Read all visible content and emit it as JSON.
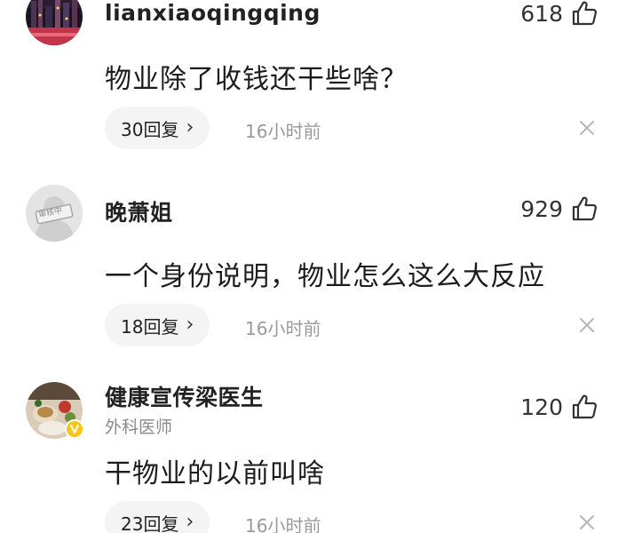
{
  "comments": [
    {
      "username": "lianxiaoqingqing",
      "likes": "618",
      "text": "物业除了收钱还干些啥？",
      "reply_label": "30回复",
      "time": "16小时前"
    },
    {
      "username": "晚萧姐",
      "avatar_stamp": "审核中",
      "likes": "929",
      "text": "一个身份说明，物业怎么这么大反应",
      "reply_label": "18回复",
      "time": "16小时前"
    },
    {
      "username": "健康宣传梁医生",
      "subtitle": "外科医师",
      "likes": "120",
      "text": "干物业的以前叫啥",
      "reply_label": "23回复",
      "time": "16小时前"
    }
  ],
  "icons": {
    "like": "thumbs-up-icon",
    "chevron": "chevron-right-icon",
    "close": "close-icon",
    "verified": "verified-badge-icon"
  },
  "colors": {
    "verified_badge": "#f5c518",
    "secondary_text": "#9a9a9a",
    "pill_background": "#f4f4f4"
  }
}
